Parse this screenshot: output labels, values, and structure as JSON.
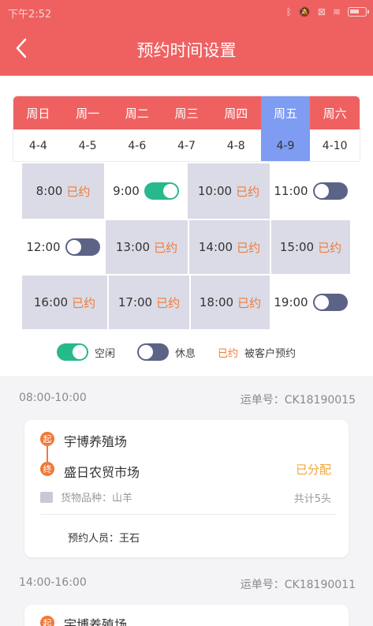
{
  "status_bar": {
    "time": "下午2:52",
    "icons": [
      "bluetooth-icon",
      "mute-icon",
      "sim-off-icon",
      "wifi-icon",
      "battery-charging-icon"
    ]
  },
  "header": {
    "title": "预约时间设置",
    "back_icon": "back-arrow-icon"
  },
  "colors": {
    "accent": "#ef6161",
    "selected": "#7e9cf2",
    "booked_text": "#f07a3a",
    "toggle_on": "#27b98c",
    "toggle_off": "#5c6386",
    "assigned": "#f0a43a"
  },
  "week": {
    "days": [
      "周日",
      "周一",
      "周二",
      "周三",
      "周四",
      "周五",
      "周六"
    ],
    "dates": [
      "4-4",
      "4-5",
      "4-6",
      "4-7",
      "4-8",
      "4-9",
      "4-10"
    ],
    "selected_index": 5
  },
  "slots": [
    {
      "time": "8:00",
      "state": "booked",
      "booked_label": "已约"
    },
    {
      "time": "9:00",
      "state": "on"
    },
    {
      "time": "10:00",
      "state": "booked",
      "booked_label": "已约"
    },
    {
      "time": "11:00",
      "state": "off"
    },
    {
      "time": "12:00",
      "state": "off"
    },
    {
      "time": "13:00",
      "state": "booked",
      "booked_label": "已约"
    },
    {
      "time": "14:00",
      "state": "booked",
      "booked_label": "已约"
    },
    {
      "time": "15:00",
      "state": "booked",
      "booked_label": "已约"
    },
    {
      "time": "16:00",
      "state": "booked",
      "booked_label": "已约"
    },
    {
      "time": "17:00",
      "state": "booked",
      "booked_label": "已约"
    },
    {
      "time": "18:00",
      "state": "booked",
      "booked_label": "已约"
    },
    {
      "time": "19:00",
      "state": "off"
    }
  ],
  "legend": {
    "free": "空闲",
    "rest": "休息",
    "booked": "已约",
    "booked_desc": "被客户预约"
  },
  "orders": [
    {
      "time_range": "08:00-10:00",
      "order_no": "运单号：CK18190015",
      "start_marker": "起",
      "end_marker": "终",
      "from": "宇博养殖场",
      "to": "盛日农贸市场",
      "status": "已分配",
      "goods": "货物品种：山羊",
      "total": "共计5头",
      "person": "预约人员：王石"
    },
    {
      "time_range": "14:00-16:00",
      "order_no": "运单号：CK18190011",
      "start_marker": "起",
      "from": "宇博养殖场"
    }
  ]
}
